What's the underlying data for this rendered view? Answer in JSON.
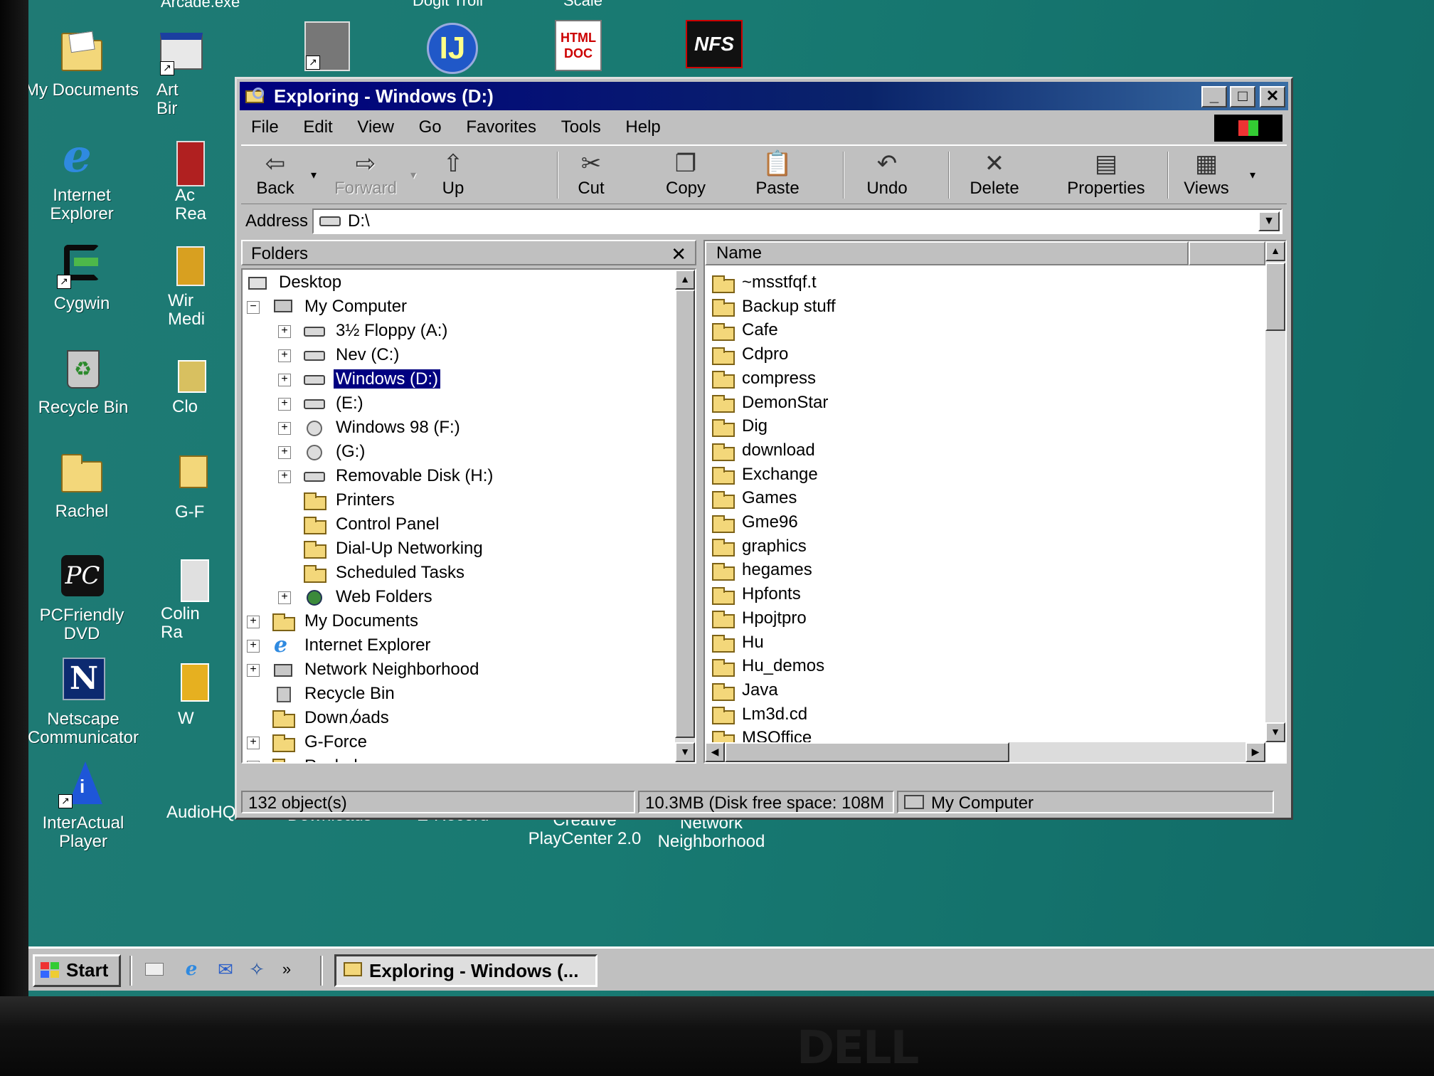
{
  "colors": {
    "desktop": "#187a72",
    "titlebar": "#00007f",
    "selection": "#000080",
    "face": "#c0c0c0"
  },
  "desktop_icons": {
    "top_partial": [
      "Arcade.exe",
      "Doglt Troll",
      "Scale"
    ],
    "my_documents": "My Documents",
    "internet_explorer": [
      "Internet",
      "Explorer"
    ],
    "cygwin": "Cygwin",
    "recycle_bin": "Recycle Bin",
    "rachel": "Rachel",
    "pcfriendly": [
      "PCFriendly",
      "DVD"
    ],
    "netscape": [
      "Netscape",
      "Communicator"
    ],
    "interactual": [
      "InterActual",
      "Player"
    ],
    "col2": [
      "Art",
      "Bir",
      "Ac",
      "Rea",
      "Wir",
      "Medi",
      "Clo",
      "G-F",
      "Colin",
      "Ra",
      "W"
    ],
    "audiohq": "AudioHQ",
    "downloads": "Downloads",
    "erecord": "E-Record",
    "creative": [
      "Creative",
      "PlayCenter 2.0"
    ],
    "network": [
      "Network",
      "Neighborhood"
    ],
    "top_row_icons": [
      "HTML DOC",
      "NFS"
    ]
  },
  "window": {
    "title": "Exploring - Windows (D:)",
    "menu": [
      "File",
      "Edit",
      "View",
      "Go",
      "Favorites",
      "Tools",
      "Help"
    ],
    "toolbar": {
      "back": "Back",
      "forward": "Forward",
      "up": "Up",
      "cut": "Cut",
      "copy": "Copy",
      "paste": "Paste",
      "undo": "Undo",
      "delete": "Delete",
      "properties": "Properties",
      "views": "Views"
    },
    "address_label": "Address",
    "address_value": "D:\\",
    "folders_title": "Folders",
    "tree": [
      "Desktop",
      "My Computer",
      "3½ Floppy (A:)",
      "Nev (C:)",
      "Windows (D:)",
      "(E:)",
      "Windows 98 (F:)",
      "(G:)",
      "Removable Disk (H:)",
      "Printers",
      "Control Panel",
      "Dial-Up Networking",
      "Scheduled Tasks",
      "Web Folders",
      "My Documents",
      "Internet Explorer",
      "Network Neighborhood",
      "Recycle Bin",
      "Downloads",
      "G-Force",
      "Rachel"
    ],
    "list_header": "Name",
    "files": [
      "~msstfqf.t",
      "Backup stuff",
      "Cafe",
      "Cdpro",
      "compress",
      "DemonStar",
      "Dig",
      "download",
      "Exchange",
      "Games",
      "Gme96",
      "graphics",
      "hegames",
      "Hpfonts",
      "Hpojtpro",
      "Hu",
      "Hu_demos",
      "Java",
      "Lm3d.cd",
      "MSOffice"
    ],
    "status": {
      "objects": "132 object(s)",
      "size": "10.3MB (Disk free space: 108M",
      "location": "My Computer"
    }
  },
  "taskbar": {
    "start": "Start",
    "task": "Exploring - Windows (...",
    "more": "»"
  },
  "monitor_brand": "DELL"
}
